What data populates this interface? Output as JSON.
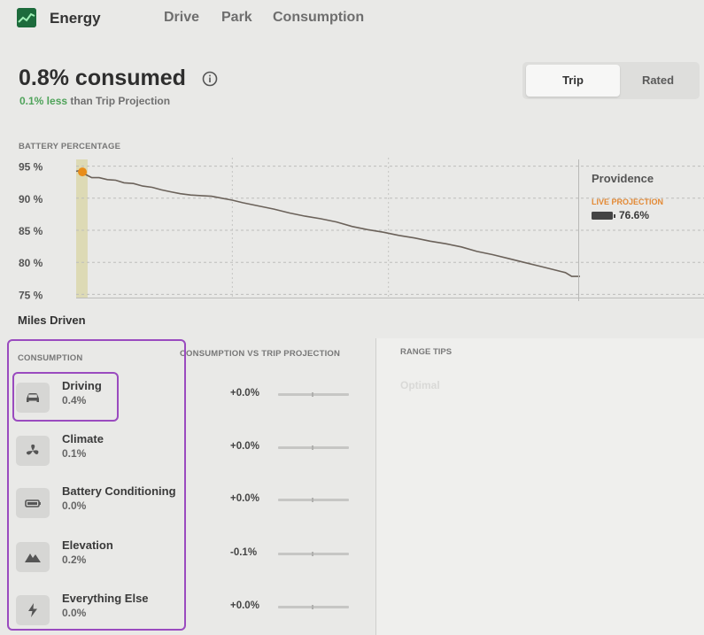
{
  "header": {
    "app_title": "Energy",
    "tabs": [
      {
        "label": "Drive"
      },
      {
        "label": "Park"
      },
      {
        "label": "Consumption"
      }
    ]
  },
  "summary": {
    "consumed": "0.8% consumed",
    "projection_highlight": "0.1% less",
    "projection_rest": "than Trip Projection"
  },
  "toggle": {
    "trip_label": "Trip",
    "rated_label": "Rated",
    "selected": "Trip"
  },
  "chart": {
    "section_label": "BATTERY PERCENTAGE",
    "x_axis_label": "Miles Driven",
    "destination": "Providence",
    "live_projection_label": "LIVE PROJECTION",
    "live_projection_value": "76.6%"
  },
  "chart_data": {
    "type": "line",
    "title": "",
    "xlabel": "Miles Driven",
    "ylabel": "BATTERY PERCENTAGE",
    "x_ticks": [
      "15",
      "30",
      "48.4"
    ],
    "y_ticks": [
      "95 %",
      "90 %",
      "85 %",
      "80 %",
      "75 %"
    ],
    "xlim": [
      0,
      48.4
    ],
    "ylim": [
      74.5,
      95.5
    ],
    "grid": true,
    "legend": "none",
    "series": [
      {
        "x": [
          0,
          0.3,
          0.9,
          1.5,
          2.2,
          3.0,
          3.8,
          4.6,
          5.5,
          6.4,
          7.3,
          8.2,
          9.1,
          10.0,
          11.0,
          12.0,
          13.0,
          14.0,
          15.0,
          16.0,
          17.5,
          19.0,
          20.5,
          22.0,
          23.5,
          25.0,
          26.5,
          28.0,
          29.5,
          31.0,
          32.5,
          34.0,
          35.5,
          37.0,
          38.5,
          40.0,
          41.5,
          43.0,
          44.5,
          46.0,
          47.0,
          47.6,
          48.4
        ],
        "y": [
          94.2,
          94.3,
          93.7,
          93.2,
          93.2,
          92.9,
          92.8,
          92.4,
          92.3,
          91.9,
          91.7,
          91.3,
          91.0,
          90.7,
          90.5,
          90.4,
          90.3,
          90.0,
          89.7,
          89.3,
          88.8,
          88.3,
          87.7,
          87.2,
          86.8,
          86.3,
          85.6,
          85.1,
          84.7,
          84.2,
          83.8,
          83.3,
          82.9,
          82.4,
          81.7,
          81.2,
          80.6,
          80.0,
          79.4,
          78.8,
          78.4,
          77.8,
          77.8
        ]
      }
    ],
    "marker": {
      "x": 0.6,
      "y": 94.1
    },
    "current_range_band": [
      0,
      1.1
    ]
  },
  "consumption": {
    "section_label": "CONSUMPTION",
    "vs_label": "CONSUMPTION VS TRIP PROJECTION",
    "items": [
      {
        "name": "Driving",
        "value": "0.4%",
        "delta": "+0.0%",
        "icon": "car-icon"
      },
      {
        "name": "Climate",
        "value": "0.1%",
        "delta": "+0.0%",
        "icon": "fan-icon"
      },
      {
        "name": "Battery Conditioning",
        "value": "0.0%",
        "delta": "+0.0%",
        "icon": "battery-icon"
      },
      {
        "name": "Elevation",
        "value": "0.2%",
        "delta": "-0.1%",
        "icon": "mountain-icon"
      },
      {
        "name": "Everything Else",
        "value": "0.0%",
        "delta": "+0.0%",
        "icon": "bolt-icon"
      }
    ]
  },
  "range_tips": {
    "label": "RANGE TIPS",
    "items": [
      "Optimal"
    ]
  },
  "colors": {
    "accent_green": "#4fa35a",
    "live_projection": "#e38934",
    "marker": "#e88d1a",
    "annotation_highlight": "#9a4bbf"
  }
}
